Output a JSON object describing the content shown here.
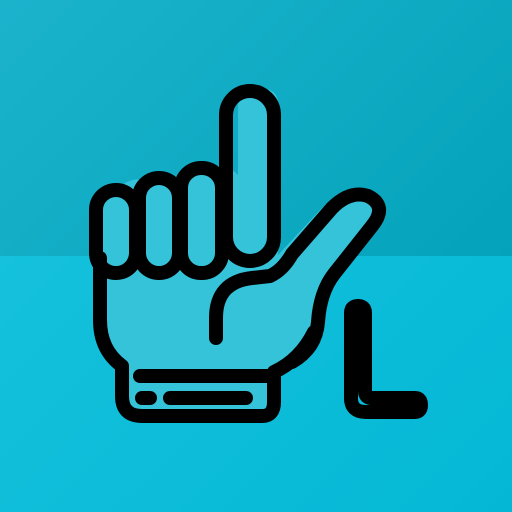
{
  "icon": {
    "name": "sign-language-letter-l-icon",
    "colors": {
      "background_top_start": "#1bb3cc",
      "background_top_end": "#04a3bb",
      "background_bottom_start": "#15c1dc",
      "background_bottom_end": "#04b8d5",
      "hand_fill": "#35c3da",
      "stroke": "#000000"
    }
  }
}
